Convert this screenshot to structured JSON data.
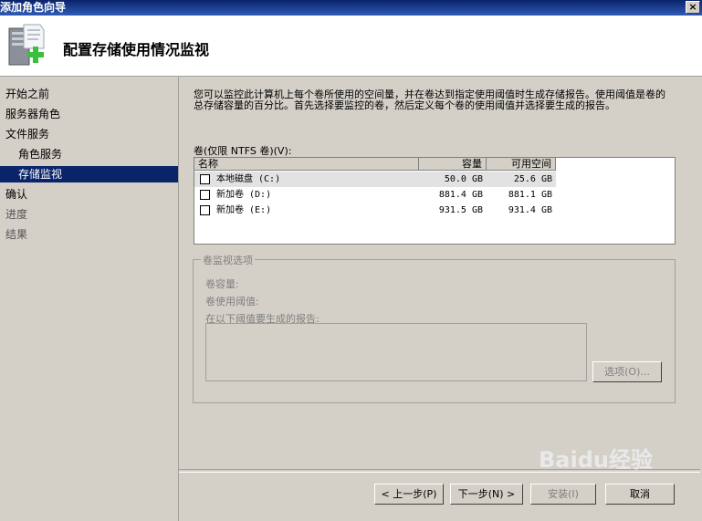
{
  "window": {
    "title": "添加角色向导",
    "close_glyph": "×"
  },
  "header": {
    "title": "配置存储使用情况监视",
    "icon": "server-add-icon"
  },
  "sidebar": {
    "items": [
      {
        "label": "开始之前"
      },
      {
        "label": "服务器角色"
      },
      {
        "label": "文件服务"
      },
      {
        "label": "角色服务"
      },
      {
        "label": "存储监视"
      },
      {
        "label": "确认"
      },
      {
        "label": "进度"
      },
      {
        "label": "结果"
      }
    ]
  },
  "main": {
    "description": "您可以监控此计算机上每个卷所使用的空间量，并在卷达到指定使用阈值时生成存储报告。使用阈值是卷的总存储容量的百分比。首先选择要监控的卷，然后定义每个卷的使用阈值并选择要生成的报告。",
    "volumes_label": "卷(仅限 NTFS 卷)(V):",
    "columns": {
      "name": "名称",
      "capacity": "容量",
      "free": "可用空间"
    },
    "volumes": [
      {
        "name": "本地磁盘 (C:)",
        "capacity": "50.0 GB",
        "free": "25.6 GB"
      },
      {
        "name": "新加卷 (D:)",
        "capacity": "881.4 GB",
        "free": "881.1 GB"
      },
      {
        "name": "新加卷 (E:)",
        "capacity": "931.5 GB",
        "free": "931.4 GB"
      }
    ],
    "group": {
      "legend": "卷监视选项",
      "capacity_label": "卷容量:",
      "threshold_label": "卷使用阈值:",
      "reports_label": "在以下阈值要生成的报告:",
      "options_button": "选项(O)..."
    }
  },
  "footer": {
    "back": "< 上一步(P)",
    "next": "下一步(N) >",
    "install": "安装(I)",
    "cancel": "取消"
  },
  "watermark": "Baidu经验"
}
